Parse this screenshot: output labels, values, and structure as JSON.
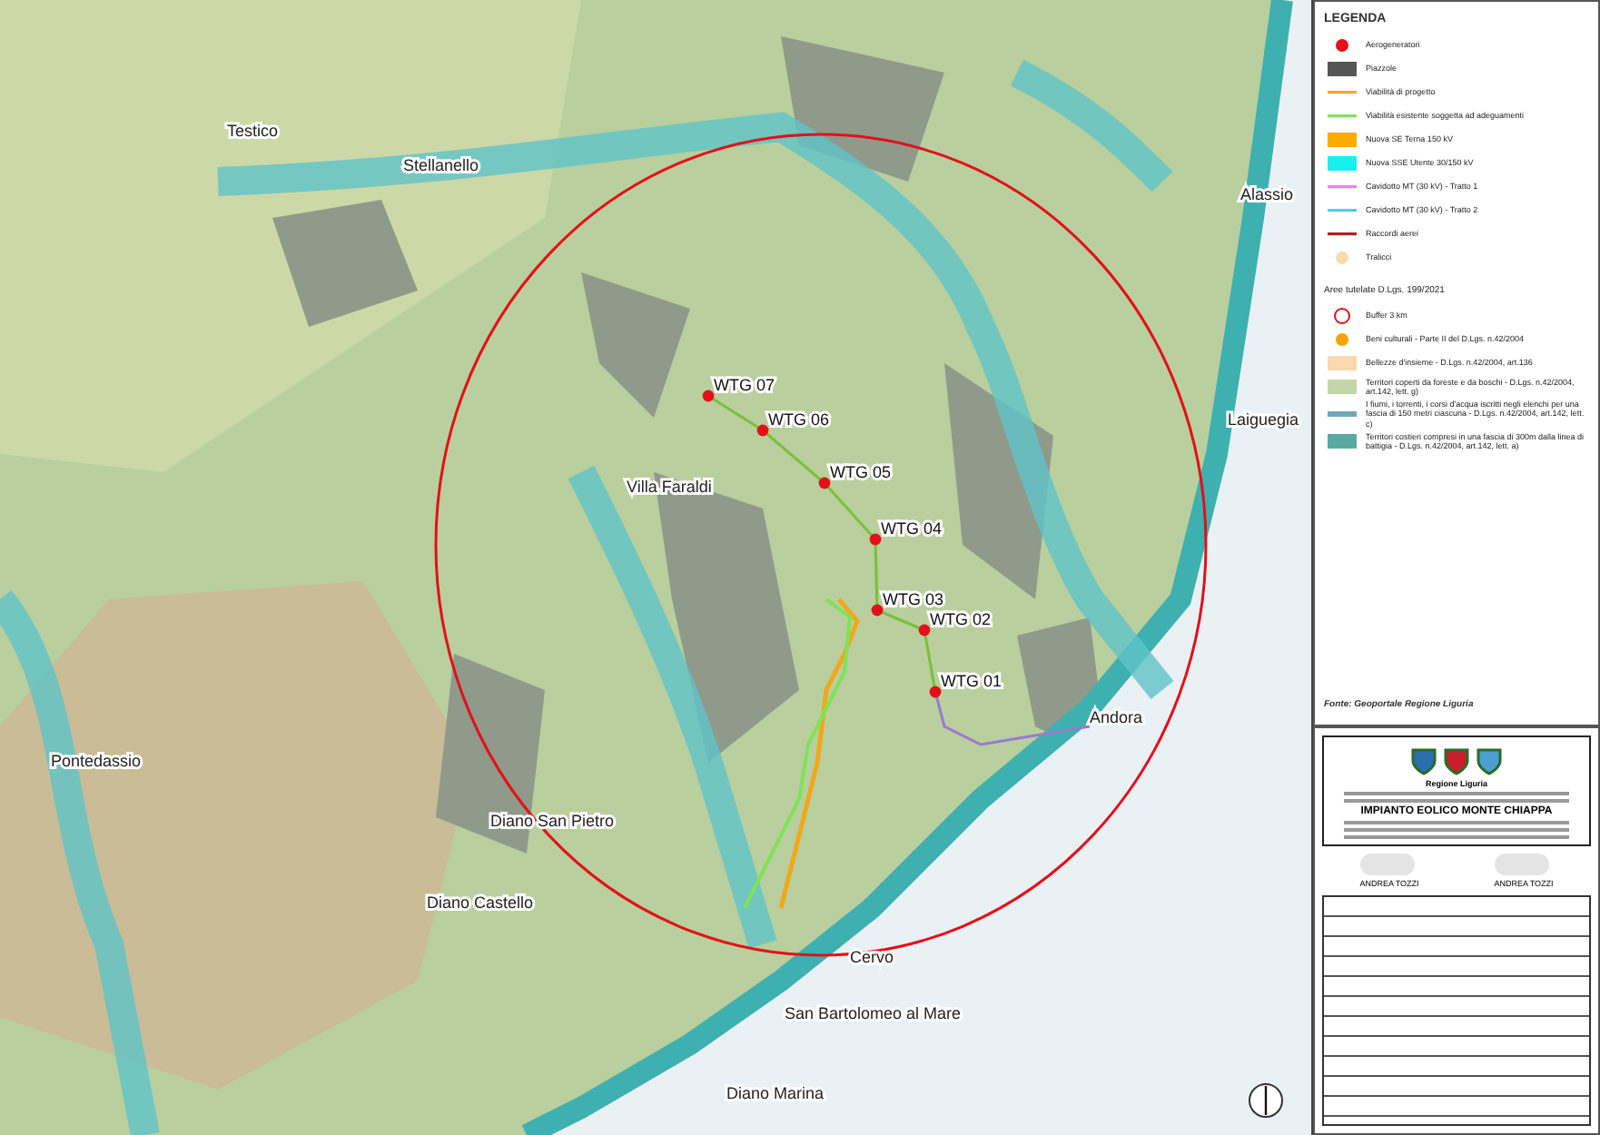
{
  "map": {
    "places": [
      "Testico",
      "Stellanello",
      "Alassio",
      "Laiguegia",
      "Andora",
      "Villa Faraldi",
      "Pontedassio",
      "Diano San Pietro",
      "Diano Castello",
      "Cervo",
      "San Bartolomeo al Mare",
      "Diano Marina"
    ],
    "turbines": [
      {
        "label": "WTG 07"
      },
      {
        "label": "WTG 06"
      },
      {
        "label": "WTG 05"
      },
      {
        "label": "WTG 04"
      },
      {
        "label": "WTG 03"
      },
      {
        "label": "WTG 02"
      },
      {
        "label": "WTG 01"
      }
    ]
  },
  "legend": {
    "title": "LEGENDA",
    "items": [
      {
        "kind": "dot",
        "color": "#e3101a",
        "label": "Aerogeneratori"
      },
      {
        "kind": "rect",
        "color": "#555555",
        "label": "Piazzole"
      },
      {
        "kind": "line",
        "color": "#f2a81c",
        "label": "Viabilità di progetto"
      },
      {
        "kind": "line",
        "color": "#7fe35a",
        "label": "Viabilità esistente soggetta ad adeguamenti"
      },
      {
        "kind": "rect",
        "color": "#ffaa00",
        "label": "Nuova SE Terna 150 kV"
      },
      {
        "kind": "rect",
        "color": "#18f0f0",
        "label": "Nuova SSE Utente 30/150 kV"
      },
      {
        "kind": "line",
        "color": "#ee82ee",
        "label": "Cavidotto MT (30 kV) - Tratto 1"
      },
      {
        "kind": "line",
        "color": "#5bc8e8",
        "label": "Cavidotto MT (30 kV) - Tratto 2"
      },
      {
        "kind": "line",
        "color": "#b02020",
        "label": "Raccordi aerei"
      },
      {
        "kind": "dot",
        "color": "#f8dcae",
        "label": "Tralicci"
      }
    ],
    "section": "Aree tutelate D.Lgs. 199/2021",
    "protected": [
      {
        "kind": "ring",
        "color": "#e3101a",
        "label": "Buffer 3 km"
      },
      {
        "kind": "dot",
        "color": "#f5a300",
        "label": "Beni culturali - Parte II del D.Lgs. n.42/2004"
      },
      {
        "kind": "rect",
        "color": "#f9d9b0",
        "label": "Bellezze d'insieme - D.Lgs. n.42/2004, art.136"
      },
      {
        "kind": "rect",
        "color": "#c4d6a8",
        "label": "Territori coperti da foreste e da boschi - D.Lgs. n.42/2004, art.142, lett. g)"
      },
      {
        "kind": "band",
        "color": "#6fa8b8",
        "label": "I fiumi, i torrenti, i corsi d'acqua iscritti negli elenchi per una fascia di 150 metri ciascuna - D.Lgs. n.42/2004, art.142, lett. c)"
      },
      {
        "kind": "rect",
        "color": "#5aa8a0",
        "label": "Territori costieri compresi in una fascia di 300m dalla linea di battigia - D.Lgs. n.42/2004, art.142, lett. a)"
      }
    ],
    "source": "Fonte: Geoportale Regione Liguria"
  },
  "title_block": {
    "region": "Regione Liguria",
    "title": "IMPIANTO EOLICO MONTE CHIAPPA",
    "signatures": [
      "ANDREA TOZZI",
      "ANDREA TOZZI"
    ]
  }
}
